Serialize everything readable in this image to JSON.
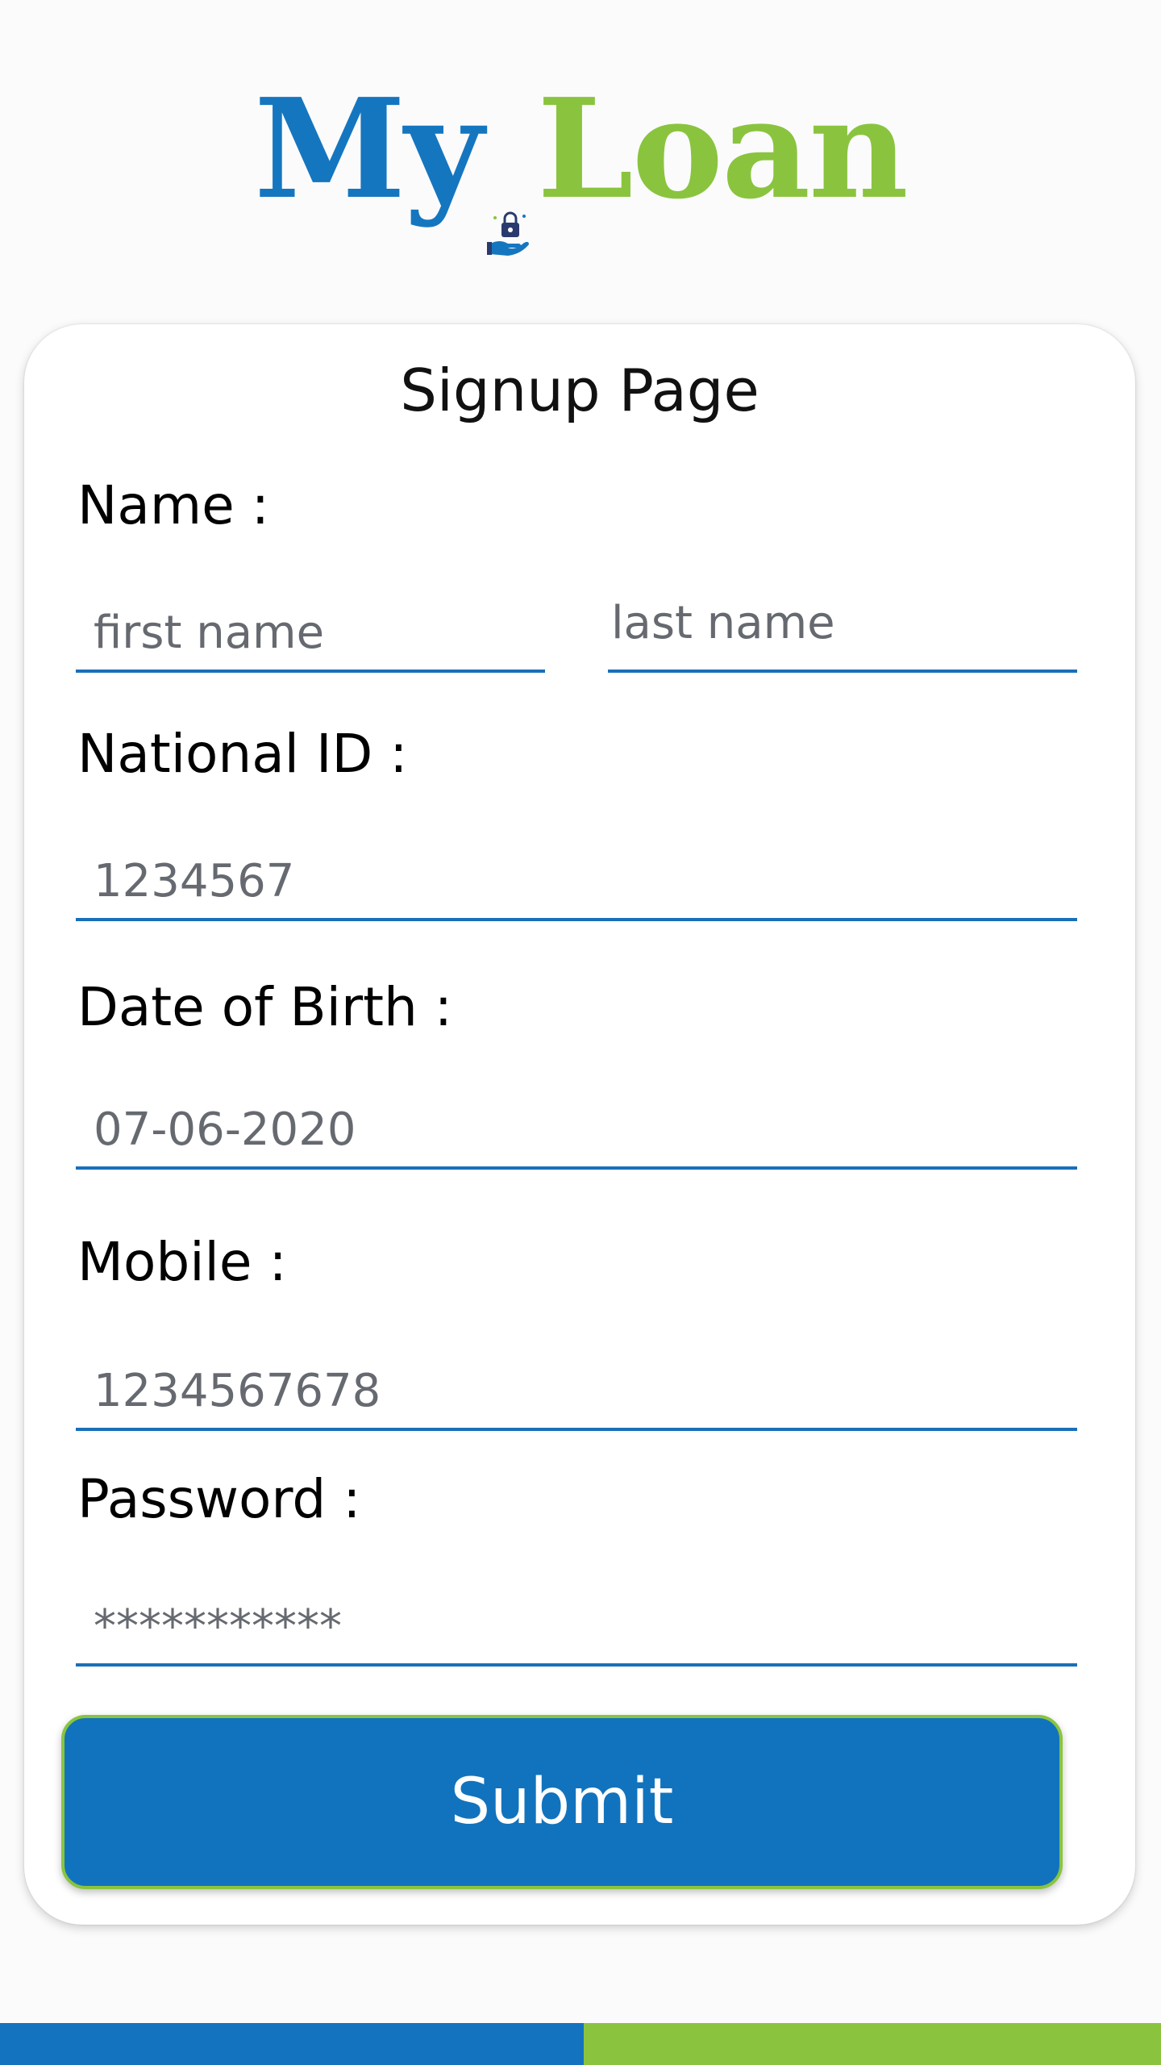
{
  "logo": {
    "part1": "My",
    "part2": "Loan",
    "icon": "hand-lock-icon"
  },
  "form": {
    "title": "Signup Page",
    "name_label": "Name :",
    "first_name_placeholder": "first name",
    "last_name_placeholder": "last name",
    "national_id_label": "National ID :",
    "national_id_placeholder": "1234567",
    "dob_label": "Date of Birth :",
    "dob_placeholder": "07-06-2020",
    "mobile_label": "Mobile :",
    "mobile_placeholder": "1234567678",
    "password_label": "Password :",
    "password_placeholder": "***********",
    "submit_label": "Submit"
  },
  "colors": {
    "brand_blue": "#1576c0",
    "brand_green": "#8ac43f",
    "field_underline": "#1a6fb8"
  }
}
